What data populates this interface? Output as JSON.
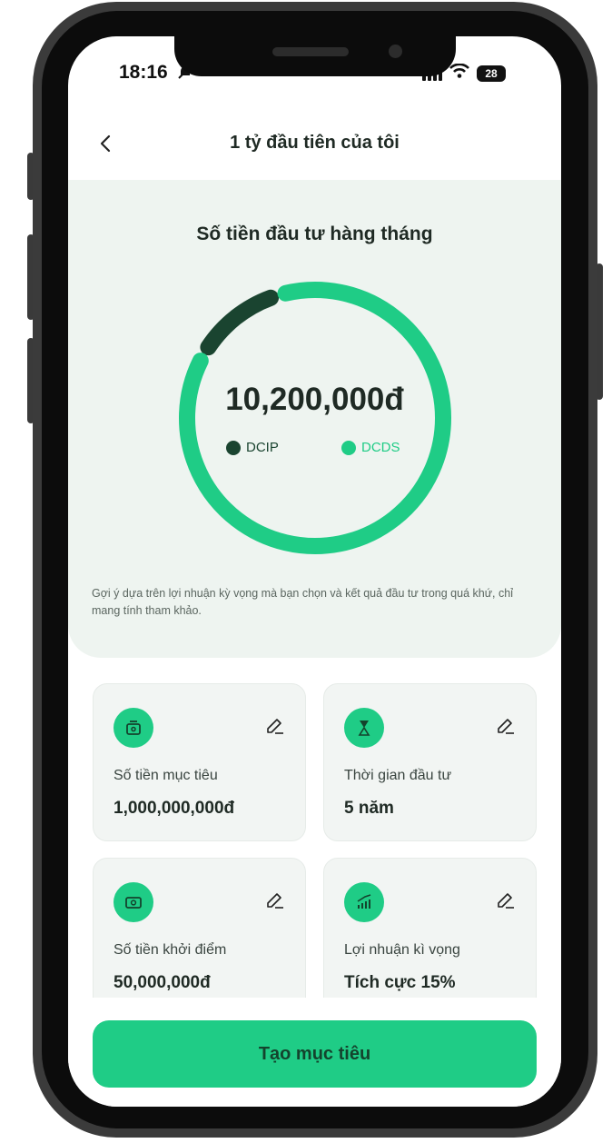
{
  "status_bar": {
    "time": "18:16",
    "battery": "28"
  },
  "header": {
    "title": "1 tỷ đầu tiên của tôi"
  },
  "summary": {
    "section_title": "Số tiền đầu tư hàng tháng",
    "total": "10,200,000đ",
    "legend": [
      {
        "label": "DCIP",
        "color": "#1a4430"
      },
      {
        "label": "DCDS",
        "color": "#1fcc86"
      }
    ],
    "disclaimer": "Gợi ý dựa trên lợi nhuận kỳ vọng mà bạn chọn và kết quả đầu tư trong quá khứ, chỉ mang tính tham khảo."
  },
  "chart_data": {
    "type": "pie",
    "categories": [
      "DCIP",
      "DCDS"
    ],
    "values": [
      12,
      88
    ],
    "colors": [
      "#1a4430",
      "#1fcc86"
    ]
  },
  "tiles": [
    {
      "icon": "wallet-icon",
      "label": "Số tiền mục tiêu",
      "value": "1,000,000,000đ"
    },
    {
      "icon": "hourglass-icon",
      "label": "Thời gian đầu tư",
      "value": "5 năm"
    },
    {
      "icon": "cash-icon",
      "label": "Số tiền khởi điểm",
      "value": "50,000,000đ"
    },
    {
      "icon": "growth-chart-icon",
      "label": "Lợi nhuận kì vọng",
      "value": "Tích cực 15%"
    }
  ],
  "cta": {
    "label": "Tạo mục tiêu"
  },
  "colors": {
    "accent": "#1fcc86",
    "dark_accent": "#1a4430",
    "card_bg": "#eef4f0"
  }
}
